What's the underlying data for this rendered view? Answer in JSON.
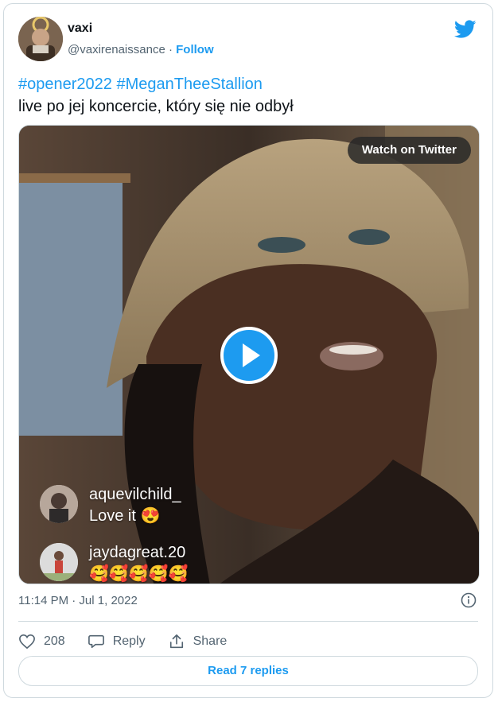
{
  "author": {
    "name": "vaxi",
    "handle": "@vaxirenaissance",
    "separator": " · ",
    "follow_label": "Follow"
  },
  "tweet": {
    "hashtags": [
      "#opener2022",
      "#MeganTheeStallion"
    ],
    "body": "live po jej koncercie, który się nie odbył"
  },
  "media": {
    "watch_label": "Watch on Twitter",
    "comments": [
      {
        "user": "aquevilchild_",
        "text": "Love it 😍"
      },
      {
        "user": "jaydagreat.20",
        "text": "🥰🥰🥰🥰🥰"
      }
    ]
  },
  "meta": {
    "timestamp": "11:14 PM · Jul 1, 2022"
  },
  "actions": {
    "like_count": "208",
    "reply_label": "Reply",
    "share_label": "Share"
  },
  "read_replies_label": "Read 7 replies",
  "colors": {
    "accent": "#1d9bf0",
    "secondary_text": "#536471",
    "border": "#cfd9de"
  }
}
